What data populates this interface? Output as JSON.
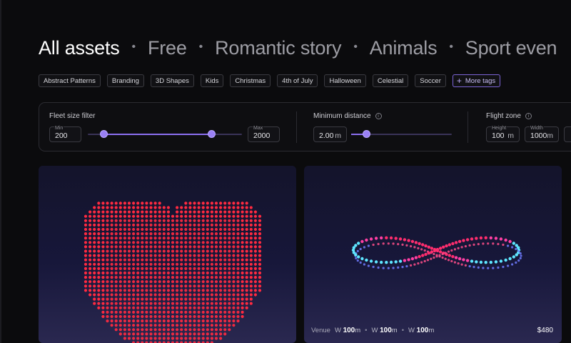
{
  "categories": [
    "All assets",
    "Free",
    "Romantic story",
    "Animals",
    "Sport even"
  ],
  "active_category": "All assets",
  "tags": [
    "Abstract Patterns",
    "Branding",
    "3D Shapes",
    "Kids",
    "Christmas",
    "4th of July",
    "Halloween",
    "Celestial",
    "Soccer"
  ],
  "more_tags_label": "More tags",
  "filters": {
    "fleet": {
      "label": "Fleet size filter",
      "min_label": "Min",
      "min_value": "200",
      "max_label": "Max",
      "max_value": "2000",
      "range_low": 0.1,
      "range_high": 0.8
    },
    "distance": {
      "label": "Minimum distance",
      "value": "2.00",
      "unit": "m",
      "level": 0.15
    },
    "flight_zone": {
      "label": "Flight zone",
      "height_label": "Height",
      "height_value": "100",
      "height_unit": "m",
      "width_label": "Width",
      "width_value": "1000",
      "width_unit": "m"
    }
  },
  "cards": [
    {
      "name": "heart",
      "color": "#ff2a40"
    },
    {
      "name": "infinity",
      "venue_label": "Venue",
      "dims": [
        {
          "prefix": "W",
          "value": "100",
          "unit": "m"
        },
        {
          "prefix": "W",
          "value": "100",
          "unit": "m"
        },
        {
          "prefix": "W",
          "value": "100",
          "unit": "m"
        }
      ],
      "price": "$480"
    }
  ],
  "colors": {
    "accent": "#8b6ff0",
    "background": "#0b0b0d"
  }
}
